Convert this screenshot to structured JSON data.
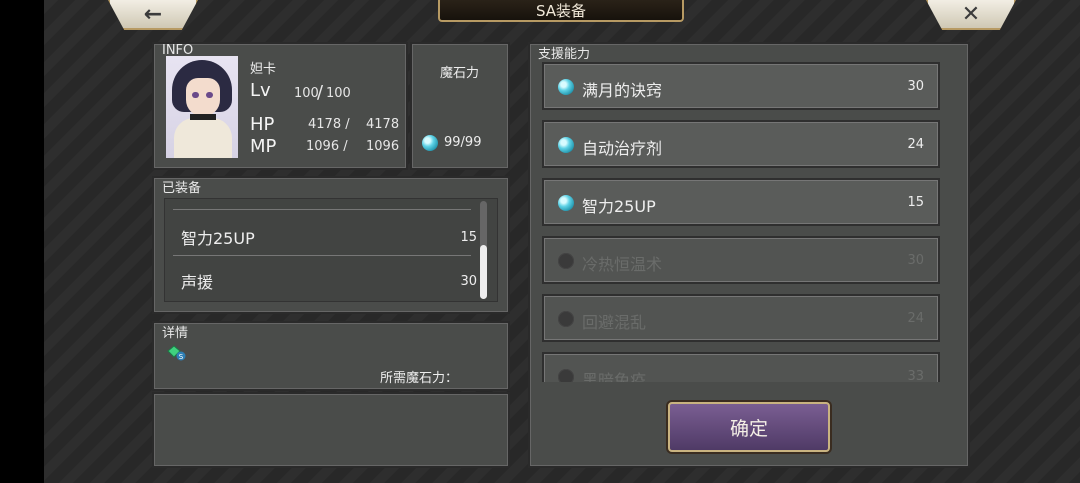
{
  "header": {
    "title": "SA装备",
    "back_glyph": "←",
    "close_glyph": "✕"
  },
  "info": {
    "label": "INFO",
    "name": "妲卡",
    "lv_label": "Lv",
    "lv": "100",
    "lv_sep": "/",
    "lv_max": "100",
    "hp_label": "HP",
    "hp": "4178 /",
    "hp_max": "4178",
    "mp_label": "MP",
    "mp": "1096 /",
    "mp_max": "1096"
  },
  "magic_power": {
    "label": "魔石力",
    "value": "99/99",
    "icon": "materia-icon"
  },
  "equipped": {
    "label": "已装备",
    "items": [
      {
        "name": "智力25UP",
        "cost": "15"
      },
      {
        "name": "声援",
        "cost": "30"
      }
    ]
  },
  "details": {
    "label": "详情",
    "required_label": "所需魔石力："
  },
  "support": {
    "label": "支援能力",
    "items": [
      {
        "name": "满月的诀窍",
        "cost": "30"
      },
      {
        "name": "自动治疗剂",
        "cost": "24"
      },
      {
        "name": "智力25UP",
        "cost": "15"
      },
      {
        "name": "冷热恒温术",
        "cost": "30"
      },
      {
        "name": "回避混乱",
        "cost": "24"
      },
      {
        "name": "黑暗免疫",
        "cost": "33"
      }
    ]
  },
  "confirm_label": "确定",
  "colors": {
    "accent_gold": "#b79a63",
    "confirm_purple": "#6a4f82",
    "materia": "#5ed2e6"
  }
}
